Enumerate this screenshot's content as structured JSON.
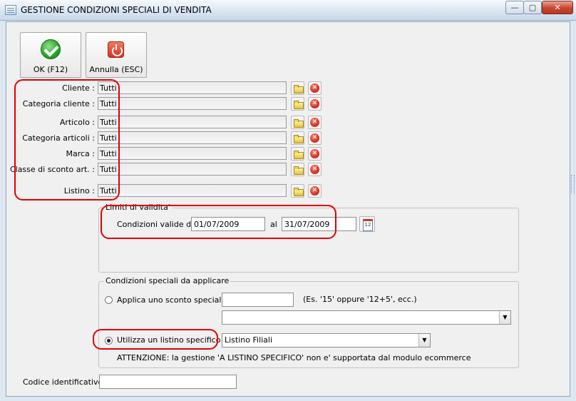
{
  "window": {
    "title": "GESTIONE CONDIZIONI SPECIALI DI VENDITA",
    "min_glyph": "—",
    "max_glyph": "▢",
    "close_glyph": "✕"
  },
  "toolbar": {
    "ok_label": "OK (F12)",
    "cancel_label": "Annulla (ESC)"
  },
  "filters": [
    {
      "label": "Cliente :",
      "value": "Tutti"
    },
    {
      "label": "Categoria cliente :",
      "value": "Tutti"
    },
    {
      "label": "Articolo :",
      "value": "Tutti"
    },
    {
      "label": "Categoria articoli :",
      "value": "Tutti"
    },
    {
      "label": "Marca :",
      "value": "Tutti"
    },
    {
      "label": "Classe di sconto art. :",
      "value": "Tutti"
    },
    {
      "label": "Listino :",
      "value": "Tutti"
    }
  ],
  "validity": {
    "group_title": "Limiti di validita'",
    "from_label": "Condizioni valide dal",
    "from_value": "01/07/2009",
    "to_label": "al",
    "to_value": "31/07/2009"
  },
  "conditions": {
    "group_title": "Condizioni speciali da applicare",
    "option_discount_label": "Applica uno sconto speciale",
    "discount_value": "",
    "discount_hint": "(Es. '15' oppure '12+5', ecc.)",
    "discount_combo_value": "",
    "option_pricelist_label": "Utilizza un listino specifico",
    "pricelist_value": "Listino Filiali",
    "warning": "ATTENZIONE: la gestione 'A LISTINO SPECIFICO' non e' supportata dal modulo ecommerce",
    "selected_option": "pricelist"
  },
  "identifier": {
    "label": "Codice identificativo :",
    "value": ""
  },
  "colors": {
    "highlight": "#e10000",
    "ok_green": "#26a326",
    "cancel_red": "#d9331a"
  }
}
